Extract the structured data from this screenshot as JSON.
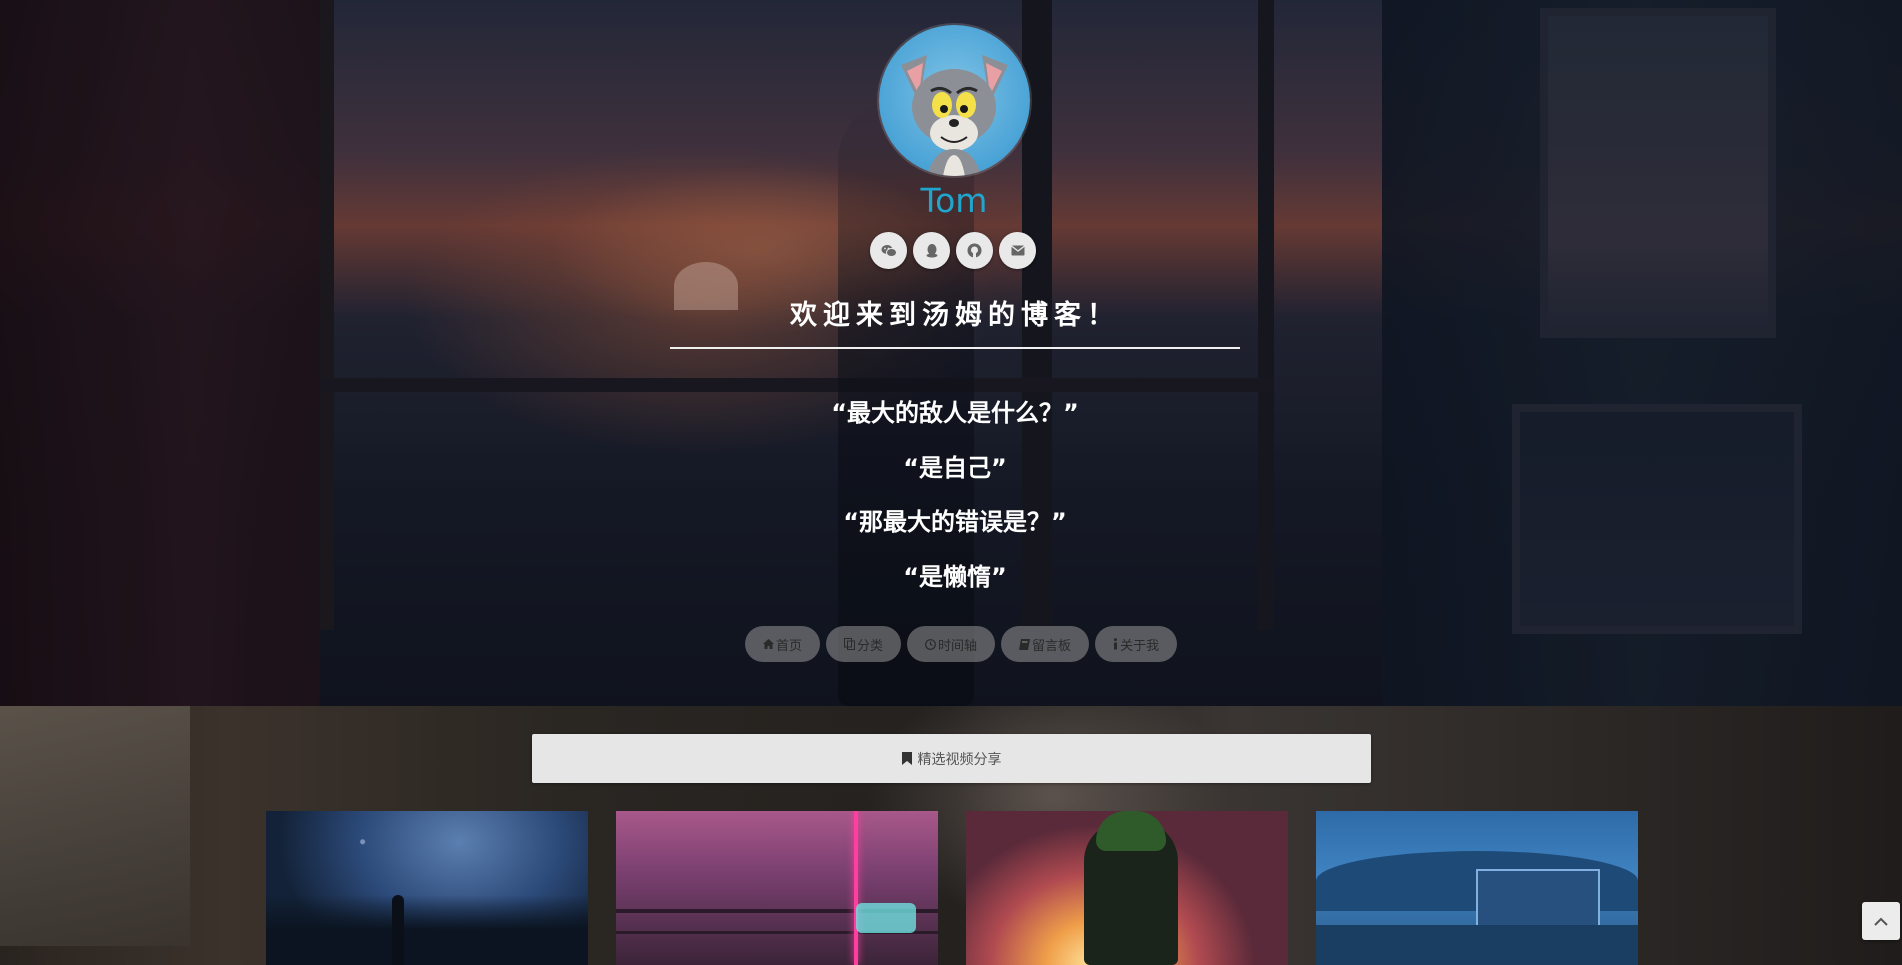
{
  "profile": {
    "name": "Tom"
  },
  "social_links": [
    {
      "icon": "wechat-icon"
    },
    {
      "icon": "qq-icon"
    },
    {
      "icon": "github-icon"
    },
    {
      "icon": "envelope-icon"
    }
  ],
  "welcome": "欢迎来到汤姆的博客！",
  "quotes": [
    "“最大的敌人是什么？”",
    "“是自己”",
    "“那最大的错误是？”",
    "“是懒惰”"
  ],
  "nav": [
    {
      "label": "首页",
      "icon": "home-icon"
    },
    {
      "label": "分类",
      "icon": "copy-icon"
    },
    {
      "label": "时间轴",
      "icon": "clock-icon"
    },
    {
      "label": "留言板",
      "icon": "book-icon"
    },
    {
      "label": "关于我",
      "icon": "info-icon"
    }
  ],
  "section": {
    "title": "精选视频分享",
    "icon": "bookmark-icon"
  },
  "videos": [
    {
      "thumb": "night-sky-video-thumbnail"
    },
    {
      "thumb": "cyberpunk-video-thumbnail"
    },
    {
      "thumb": "anime-hero-video-thumbnail"
    },
    {
      "thumb": "village-video-thumbnail"
    }
  ],
  "back_to_top": {
    "icon": "chevron-up-icon"
  },
  "colors": {
    "name_accent": "#1fa6cf",
    "nav_pill": "#969696",
    "section_bar": "#e6e6e6"
  }
}
